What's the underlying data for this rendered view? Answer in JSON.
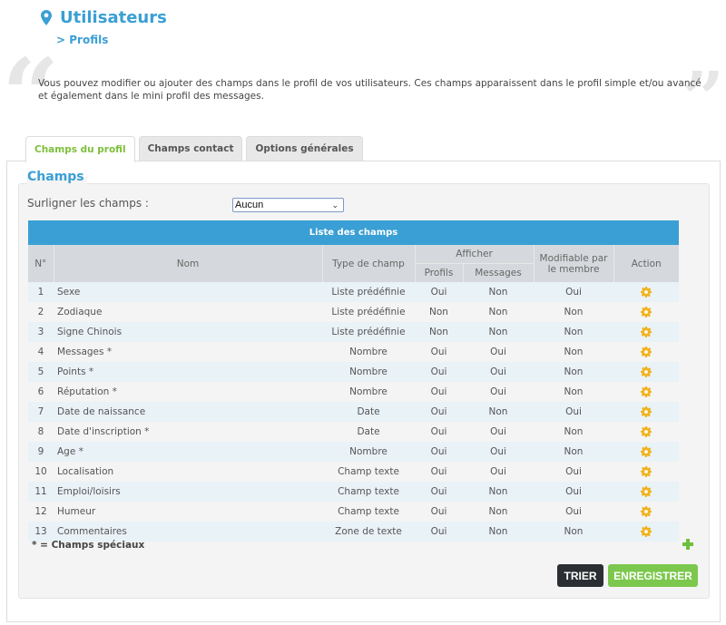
{
  "header": {
    "title": "Utilisateurs",
    "breadcrumb": "> Profils",
    "title_icon": "map-pin-icon",
    "accent_color": "#3a9fd4"
  },
  "description": {
    "open_quote": "“",
    "close_quote": "”",
    "text": "Vous pouvez modifier ou ajouter des champs dans le profil de vos utilisateurs. Ces champs apparaissent dans le profil simple et/ou avancé et également dans le mini profil des messages."
  },
  "tabs": [
    {
      "label": "Champs du profil",
      "active": true
    },
    {
      "label": "Champs contact",
      "active": false
    },
    {
      "label": "Options générales",
      "active": false
    }
  ],
  "fieldset": {
    "legend": "Champs",
    "highlight_label": "Surligner les champs :",
    "highlight_value": "Aucun"
  },
  "table": {
    "caption": "Liste des champs",
    "headers": {
      "num": "N°",
      "nom": "Nom",
      "type": "Type de champ",
      "afficher": "Afficher",
      "profils": "Profils",
      "messages": "Messages",
      "modifiable": "Modifiable par le membre",
      "action": "Action"
    },
    "rows": [
      {
        "num": "1",
        "nom": "Sexe",
        "type": "Liste prédéfinie",
        "profils": "Oui",
        "messages": "Non",
        "modifiable": "Oui"
      },
      {
        "num": "2",
        "nom": "Zodiaque",
        "type": "Liste prédéfinie",
        "profils": "Non",
        "messages": "Non",
        "modifiable": "Non"
      },
      {
        "num": "3",
        "nom": "Signe Chinois",
        "type": "Liste prédéfinie",
        "profils": "Non",
        "messages": "Non",
        "modifiable": "Non"
      },
      {
        "num": "4",
        "nom": "Messages *",
        "type": "Nombre",
        "profils": "Oui",
        "messages": "Oui",
        "modifiable": "Non"
      },
      {
        "num": "5",
        "nom": "Points *",
        "type": "Nombre",
        "profils": "Oui",
        "messages": "Oui",
        "modifiable": "Non"
      },
      {
        "num": "6",
        "nom": "Réputation *",
        "type": "Nombre",
        "profils": "Oui",
        "messages": "Oui",
        "modifiable": "Non"
      },
      {
        "num": "7",
        "nom": "Date de naissance",
        "type": "Date",
        "profils": "Oui",
        "messages": "Non",
        "modifiable": "Oui"
      },
      {
        "num": "8",
        "nom": "Date d'inscription *",
        "type": "Date",
        "profils": "Oui",
        "messages": "Oui",
        "modifiable": "Non"
      },
      {
        "num": "9",
        "nom": "Age *",
        "type": "Nombre",
        "profils": "Oui",
        "messages": "Oui",
        "modifiable": "Non"
      },
      {
        "num": "10",
        "nom": "Localisation",
        "type": "Champ texte",
        "profils": "Oui",
        "messages": "Oui",
        "modifiable": "Oui"
      },
      {
        "num": "11",
        "nom": "Emploi/loisirs",
        "type": "Champ texte",
        "profils": "Oui",
        "messages": "Non",
        "modifiable": "Oui"
      },
      {
        "num": "12",
        "nom": "Humeur",
        "type": "Champ texte",
        "profils": "Oui",
        "messages": "Non",
        "modifiable": "Oui"
      },
      {
        "num": "13",
        "nom": "Commentaires",
        "type": "Zone de texte",
        "profils": "Oui",
        "messages": "Non",
        "modifiable": "Non"
      }
    ],
    "action_icon": "gear-icon",
    "action_color": "#f0b21f"
  },
  "footer": {
    "special_note": "* = Champs spéciaux",
    "add_icon": "plus-icon",
    "sort_label": "TRIER",
    "save_label": "ENREGISTRER"
  }
}
